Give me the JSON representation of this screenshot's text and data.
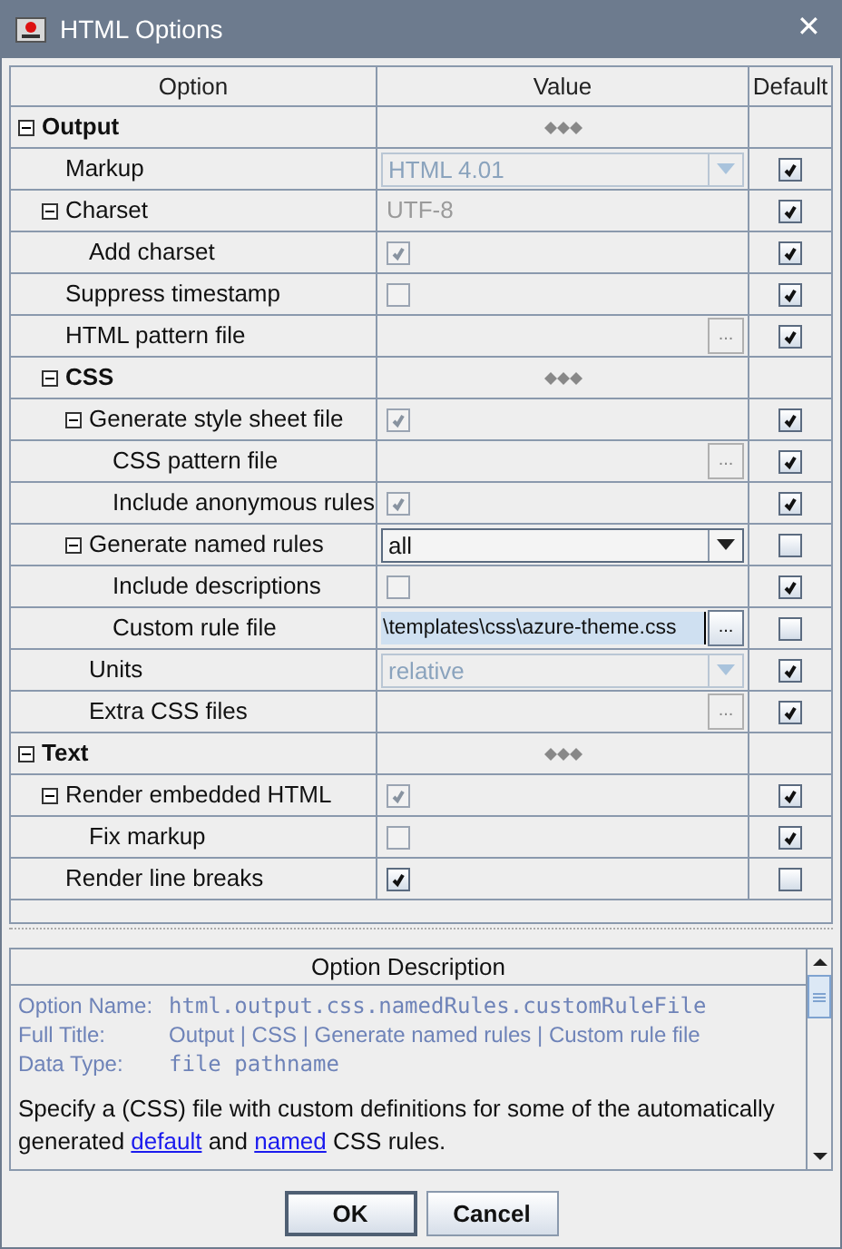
{
  "window": {
    "title": "HTML Options",
    "close": "✕"
  },
  "table": {
    "columns": [
      "Option",
      "Value",
      "Default"
    ],
    "rows": [
      {
        "label": "Output",
        "kind": "group",
        "expanded": true,
        "children": [
          {
            "label": "Markup",
            "value": {
              "kind": "combo",
              "text": "HTML 4.01",
              "disabled": true
            },
            "default": true
          },
          {
            "label": "Charset",
            "expanded": true,
            "value": {
              "kind": "text",
              "text": "UTF-8",
              "disabled": true
            },
            "default": true,
            "children": [
              {
                "label": "Add charset",
                "value": {
                  "kind": "checkbox",
                  "checked": true,
                  "disabled": true
                },
                "default": true
              }
            ]
          },
          {
            "label": "Suppress timestamp",
            "value": {
              "kind": "checkbox",
              "checked": false,
              "disabled": true
            },
            "default": true
          },
          {
            "label": "HTML pattern file",
            "value": {
              "kind": "file",
              "button": "...",
              "disabled": true
            },
            "default": true
          },
          {
            "label": "CSS",
            "kind": "group",
            "expanded": true,
            "children": [
              {
                "label": "Generate style sheet file",
                "expanded": true,
                "value": {
                  "kind": "checkbox",
                  "checked": true,
                  "disabled": true
                },
                "default": true,
                "children": [
                  {
                    "label": "CSS pattern file",
                    "value": {
                      "kind": "file",
                      "button": "...",
                      "disabled": true
                    },
                    "default": true
                  },
                  {
                    "label": "Include anonymous rules",
                    "value": {
                      "kind": "checkbox",
                      "checked": true,
                      "disabled": true
                    },
                    "default": true
                  }
                ]
              },
              {
                "label": "Generate named rules",
                "expanded": true,
                "value": {
                  "kind": "combo",
                  "text": "all",
                  "disabled": false
                },
                "default": false,
                "children": [
                  {
                    "label": "Include descriptions",
                    "value": {
                      "kind": "checkbox",
                      "checked": false,
                      "disabled": true
                    },
                    "default": true
                  },
                  {
                    "label": "Custom rule file",
                    "value": {
                      "kind": "file",
                      "text": "\\templates\\css\\azure-theme.css",
                      "button": "...",
                      "disabled": false
                    },
                    "default": false
                  }
                ]
              },
              {
                "label": "Units",
                "value": {
                  "kind": "combo",
                  "text": "relative",
                  "disabled": true
                },
                "default": true
              },
              {
                "label": "Extra CSS files",
                "value": {
                  "kind": "file",
                  "button": "...",
                  "disabled": true
                },
                "default": true
              }
            ]
          }
        ]
      },
      {
        "label": "Text",
        "kind": "group",
        "expanded": true,
        "children": [
          {
            "label": "Render embedded HTML",
            "expanded": true,
            "value": {
              "kind": "checkbox",
              "checked": true,
              "disabled": true
            },
            "default": true,
            "children": [
              {
                "label": "Fix markup",
                "value": {
                  "kind": "checkbox",
                  "checked": false,
                  "disabled": true
                },
                "default": true
              }
            ]
          },
          {
            "label": "Render line breaks",
            "value": {
              "kind": "checkbox",
              "checked": true,
              "disabled": false
            },
            "default": false
          }
        ]
      }
    ]
  },
  "description": {
    "title": "Option Description",
    "fields": [
      {
        "label": "Option Name:",
        "value": "html.output.css.namedRules.customRuleFile",
        "kind": "code"
      },
      {
        "label": "Full Title:",
        "value": "Output | CSS | Generate named rules | Custom rule file",
        "kind": "text"
      },
      {
        "label": "Data Type:",
        "value": "file pathname",
        "kind": "code"
      }
    ],
    "text": [
      {
        "kind": "text",
        "text": "Specify a (CSS) file with custom definitions for some of the automatically generated "
      },
      {
        "kind": "link",
        "text": "default"
      },
      {
        "kind": "text",
        "text": " and "
      },
      {
        "kind": "link",
        "text": "named"
      },
      {
        "kind": "text",
        "text": " CSS rules."
      }
    ]
  },
  "buttons": [
    "OK",
    "Cancel"
  ]
}
